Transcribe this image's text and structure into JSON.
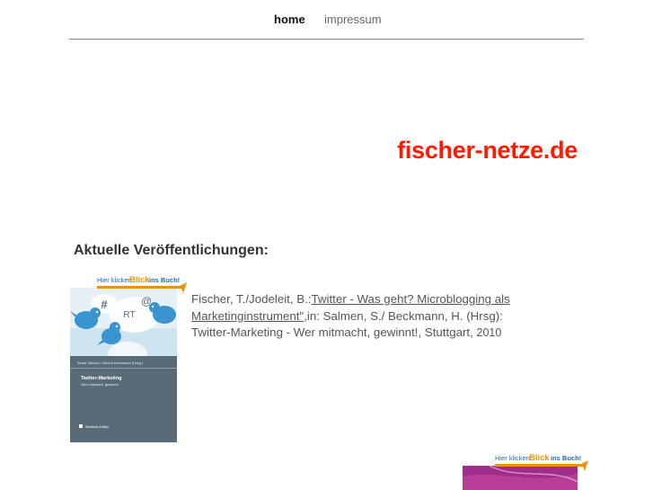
{
  "nav": {
    "home_label": "home",
    "impressum_label": "impressum"
  },
  "site": {
    "title": "fischer-netze.de"
  },
  "section": {
    "heading": "Aktuelle Veröffentlichungen:"
  },
  "publication": {
    "authors": "Fischer, T./Jodeleit, B.:",
    "link_text_1": "Twitter - Was geht? Microblogging als",
    "link_text_2": "Marketinginstrument\"",
    "after_link": ",in: Salmen, S./ Beckmann, H. (Hrsg):",
    "line_3": "Twitter-Marketing - Wer mitmacht, gewinnt!, Stuttgart,",
    "year": "2010"
  },
  "book_cover": {
    "banner_part1": "Hier klicken",
    "banner_part2": "Blick",
    "banner_part3": "ins Buch!",
    "symbols": [
      "#",
      "@",
      "RT"
    ],
    "editors": "Sonja Salmen, Helmut Beckmann (Hrsg.)",
    "book_title": "Twitter-Marketing",
    "book_subtitle": "Wer mitmacht, gewinnt!",
    "publisher": "Steinbeis-Edition"
  },
  "colors": {
    "title_red": "#ff1a00",
    "banner_orange": "#f39200",
    "banner_blue": "#1e6bb8",
    "cover_sky": "#cfe4f1",
    "cover_band": "#5a6b78",
    "bird_blue": "#3a94cf",
    "second_cover_purple": "#a22c8a"
  }
}
